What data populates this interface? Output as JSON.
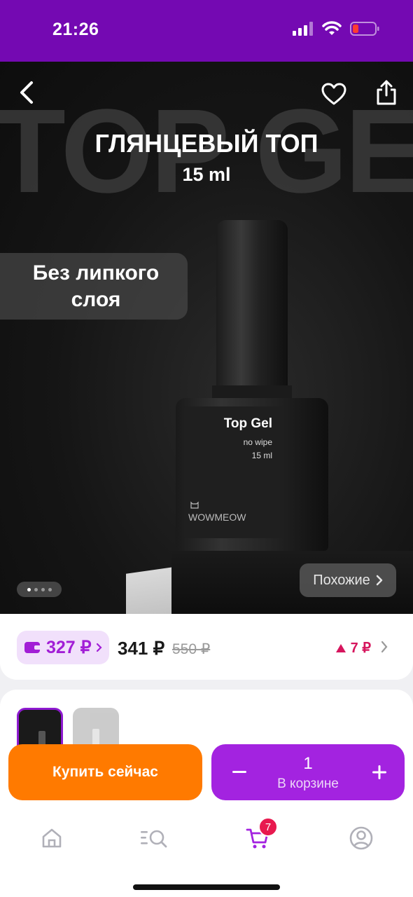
{
  "status_bar": {
    "time": "21:26",
    "icons": [
      "signal-icon",
      "wifi-icon",
      "battery-icon"
    ],
    "background": "#7409b2"
  },
  "hero": {
    "background_text": "TOP GEL",
    "title": "ГЛЯНЦЕВЫЙ ТОП",
    "subtitle": "15 ml",
    "tag": "Без липкого слоя",
    "bottle_label": {
      "name": "Top Gel",
      "line1": "no wipe",
      "line2": "15 ml",
      "brand": "WOWMEOW"
    },
    "carousel_total": 4,
    "carousel_active": 1,
    "similar_label": "Похожие"
  },
  "price": {
    "wallet_price": "327 ₽",
    "current": "341 ₽",
    "old": "550 ₽",
    "delta": "7 ₽"
  },
  "actions": {
    "buy_now": "Купить сейчас",
    "cart_qty": "1",
    "cart_label": "В корзине"
  },
  "tab_bar": {
    "items": [
      "home-icon",
      "catalog-icon",
      "cart-icon",
      "profile-icon"
    ],
    "cart_badge": "7"
  },
  "colors": {
    "accent_purple": "#a323e0",
    "accent_orange": "#ff7a00",
    "price_delta": "#d6155d",
    "wallet": "#a21ed6"
  }
}
